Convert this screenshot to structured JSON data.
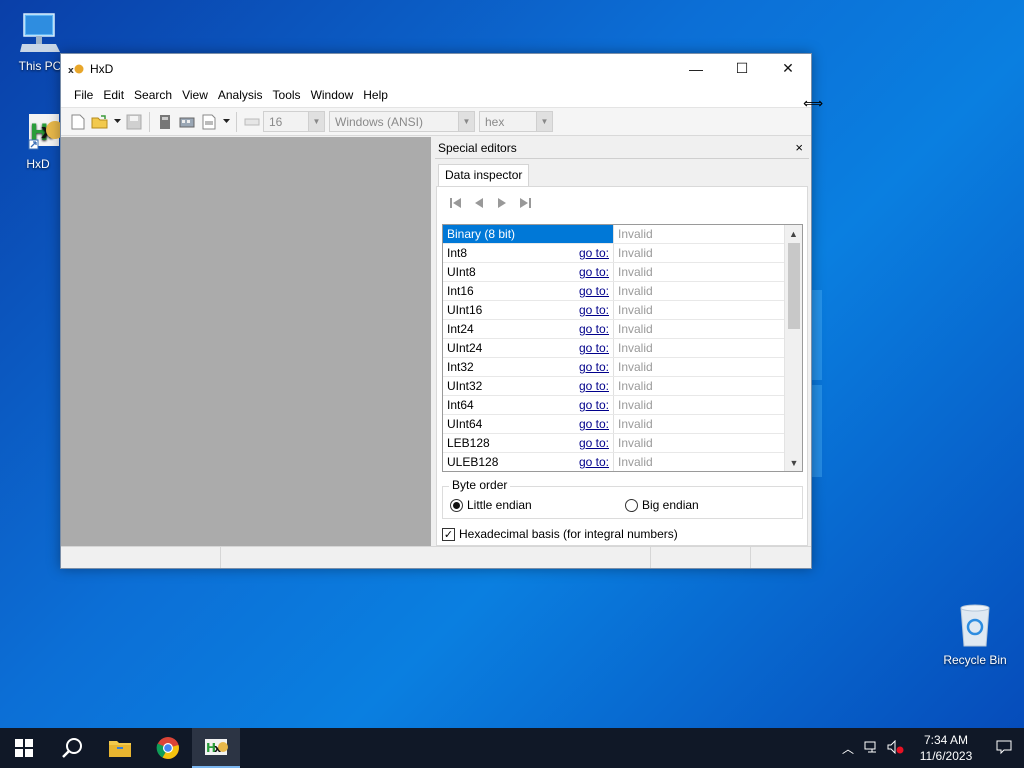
{
  "desktop": {
    "icons": [
      {
        "label": "This PC"
      },
      {
        "label": "HxD"
      },
      {
        "label": "Recycle Bin"
      }
    ]
  },
  "window": {
    "title": "HxD",
    "controls": {
      "minimize": "—",
      "maximize": "☐",
      "close": "✕"
    }
  },
  "menu": [
    "File",
    "Edit",
    "Search",
    "View",
    "Analysis",
    "Tools",
    "Window",
    "Help"
  ],
  "toolbar": {
    "bytes_per_row": "16",
    "charset": "Windows (ANSI)",
    "offset_base": "hex"
  },
  "special_editors": {
    "title": "Special editors",
    "close": "×",
    "tab": "Data inspector",
    "rows": [
      {
        "name": "Binary (8 bit)",
        "goto": "",
        "value": "Invalid"
      },
      {
        "name": "Int8",
        "goto": "go to:",
        "value": "Invalid"
      },
      {
        "name": "UInt8",
        "goto": "go to:",
        "value": "Invalid"
      },
      {
        "name": "Int16",
        "goto": "go to:",
        "value": "Invalid"
      },
      {
        "name": "UInt16",
        "goto": "go to:",
        "value": "Invalid"
      },
      {
        "name": "Int24",
        "goto": "go to:",
        "value": "Invalid"
      },
      {
        "name": "UInt24",
        "goto": "go to:",
        "value": "Invalid"
      },
      {
        "name": "Int32",
        "goto": "go to:",
        "value": "Invalid"
      },
      {
        "name": "UInt32",
        "goto": "go to:",
        "value": "Invalid"
      },
      {
        "name": "Int64",
        "goto": "go to:",
        "value": "Invalid"
      },
      {
        "name": "UInt64",
        "goto": "go to:",
        "value": "Invalid"
      },
      {
        "name": "LEB128",
        "goto": "go to:",
        "value": "Invalid"
      },
      {
        "name": "ULEB128",
        "goto": "go to:",
        "value": "Invalid"
      }
    ],
    "byte_order": {
      "legend": "Byte order",
      "little": "Little endian",
      "big": "Big endian",
      "selected": "little"
    },
    "hex_basis": {
      "label": "Hexadecimal basis (for integral numbers)",
      "checked": true
    }
  },
  "taskbar": {
    "time": "7:34 AM",
    "date": "11/6/2023"
  }
}
